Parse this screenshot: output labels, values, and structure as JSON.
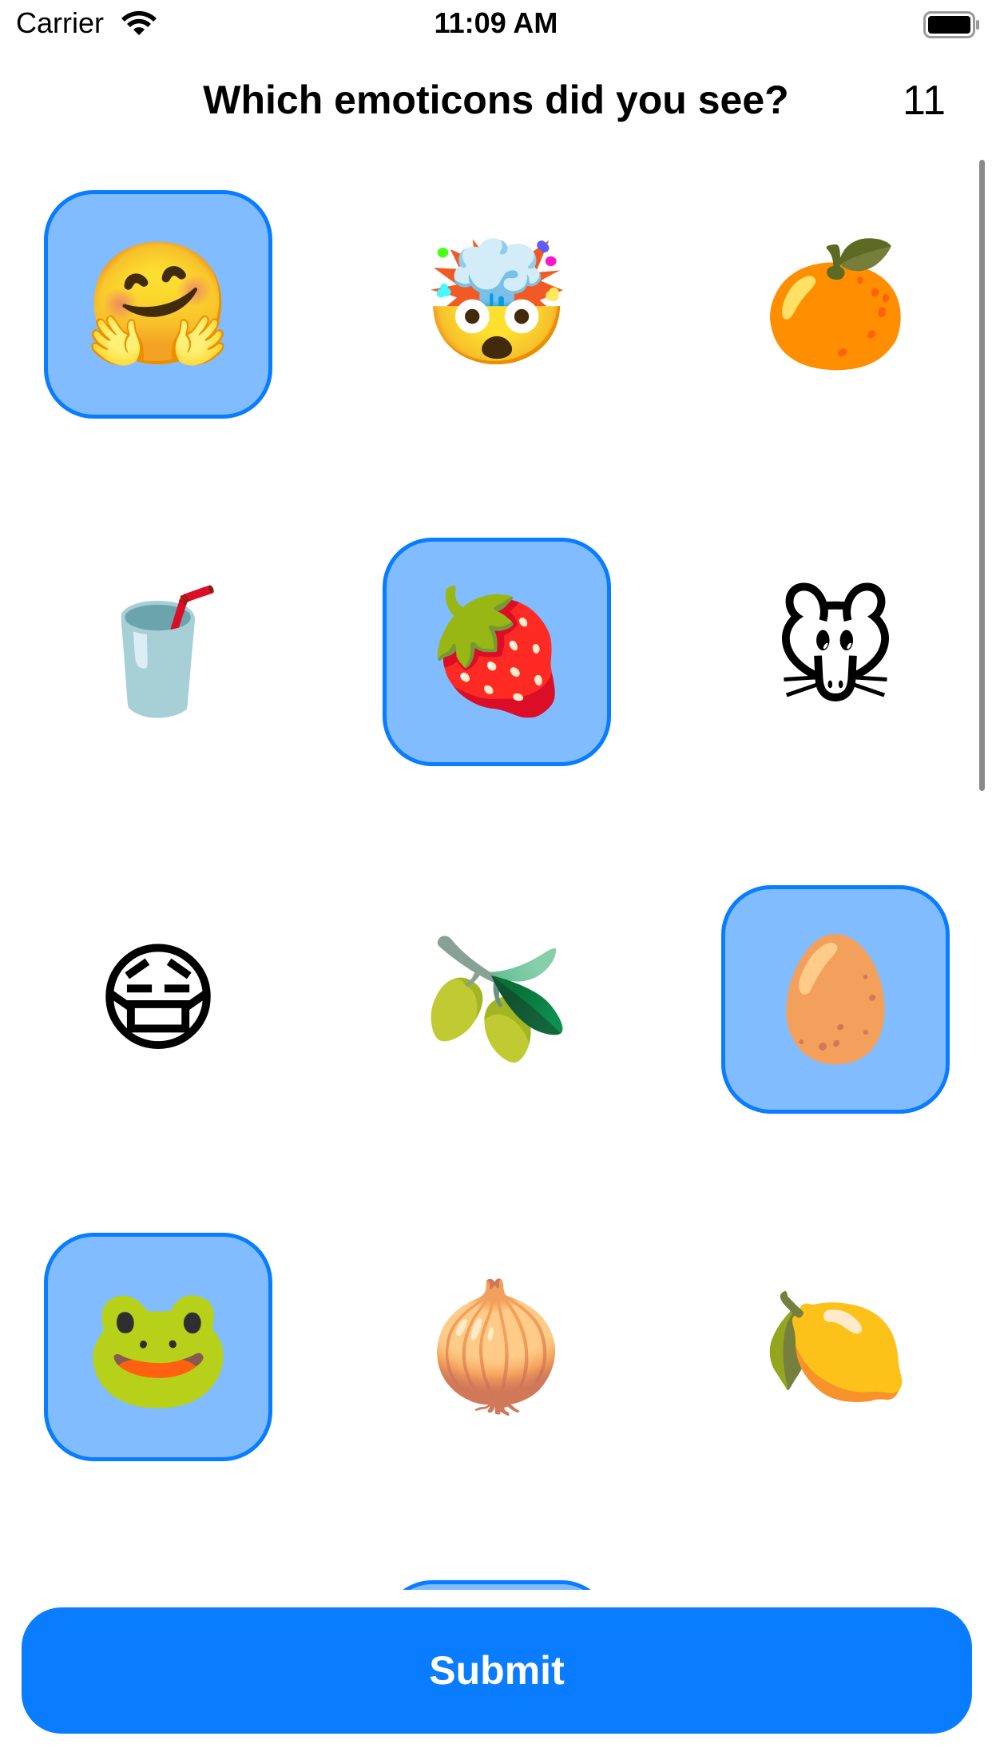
{
  "status_bar": {
    "carrier": "Carrier",
    "time": "11:09 AM",
    "wifi_icon": "wifi-icon",
    "battery_icon": "battery-icon"
  },
  "header": {
    "title": "Which emoticons did you see?",
    "count": "11"
  },
  "grid": {
    "items": [
      {
        "emoji": "🤗",
        "name": "hugging-face",
        "selected": true
      },
      {
        "emoji": "🤯",
        "name": "exploding-head",
        "selected": false
      },
      {
        "emoji": "🍊",
        "name": "tangerine",
        "selected": false
      },
      {
        "emoji": "🥤",
        "name": "cup-with-straw",
        "selected": false
      },
      {
        "emoji": "🍓",
        "name": "strawberry",
        "selected": true
      },
      {
        "emoji": "🐭",
        "name": "mouse-face",
        "selected": false
      },
      {
        "emoji": "😷",
        "name": "face-with-mask",
        "selected": false
      },
      {
        "emoji": "🫒",
        "name": "olive",
        "selected": false
      },
      {
        "emoji": "🥚",
        "name": "egg",
        "selected": true
      },
      {
        "emoji": "🐸",
        "name": "frog-face",
        "selected": true
      },
      {
        "emoji": "🧅",
        "name": "onion",
        "selected": false
      },
      {
        "emoji": "🍋",
        "name": "lemon",
        "selected": false
      },
      {
        "emoji": "",
        "name": "partial-item",
        "selected": true
      }
    ]
  },
  "submit": {
    "label": "Submit"
  },
  "colors": {
    "accent": "#0a7cff",
    "selected_fill": "#80bcff"
  }
}
